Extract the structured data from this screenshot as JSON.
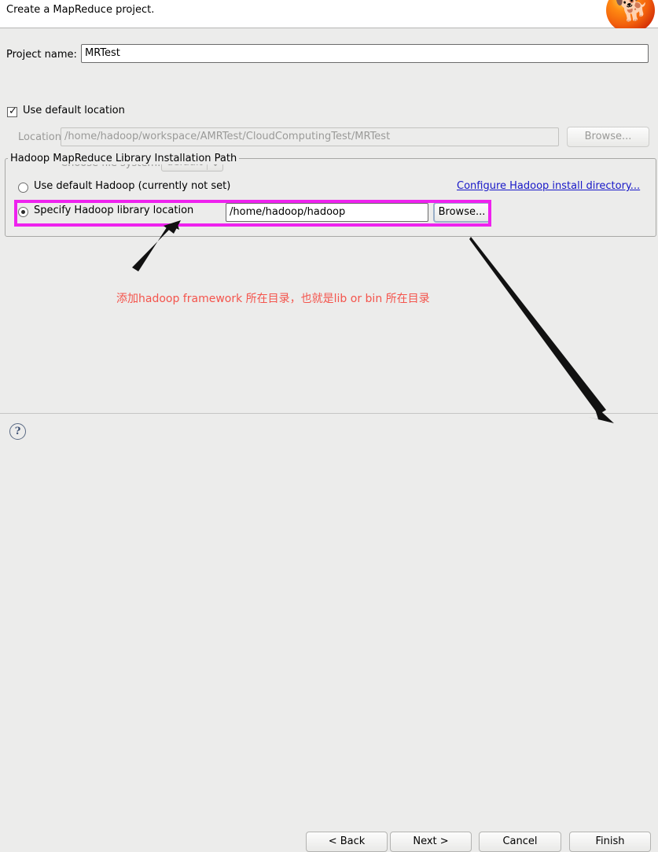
{
  "header": {
    "title": "Create a MapReduce project.",
    "logo_icon": "hadoop-elephant-logo"
  },
  "form": {
    "project_name_label": "Project name:",
    "project_name_value": "MRTest",
    "use_default_location_label": "Use default location",
    "use_default_location_checked": true,
    "location_label": "Location:",
    "location_value": "/home/hadoop/workspace/AMRTest/CloudComputingTest/MRTest",
    "location_browse_label": "Browse...",
    "choose_file_system_label": "Choose file system:",
    "file_system_value": "default"
  },
  "library_group": {
    "title": "Hadoop MapReduce Library Installation Path",
    "option_default_label": "Use default Hadoop (currently not set)",
    "option_default_selected": false,
    "option_specify_label": "Specify Hadoop library location",
    "option_specify_selected": true,
    "library_path_value": "/home/hadoop/hadoop",
    "library_browse_label": "Browse...",
    "configure_link_label": "Configure Hadoop install directory...",
    "highlight_color": "#ee22ee"
  },
  "annotation": {
    "text": "添加hadoop framework 所在目录，也就是lib or bin 所在目录",
    "color": "#f4544c"
  },
  "footer": {
    "help_label": "?",
    "back_label": "< Back",
    "next_label": "Next >",
    "cancel_label": "Cancel",
    "finish_label": "Finish"
  }
}
